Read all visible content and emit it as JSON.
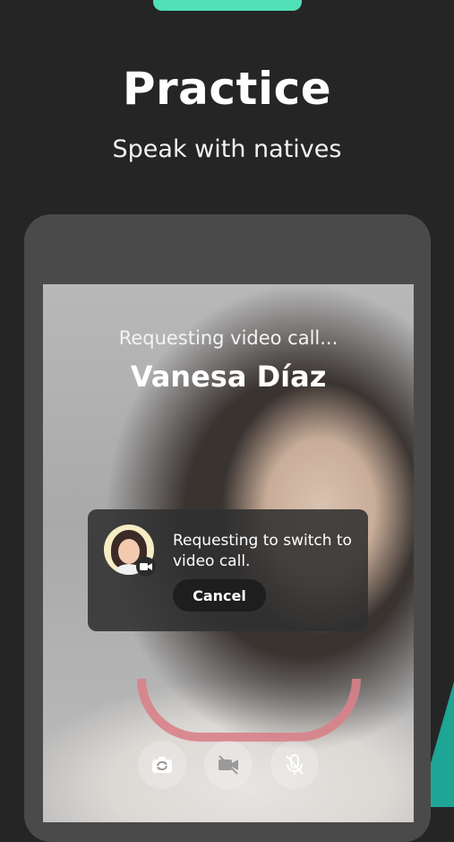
{
  "hero": {
    "title": "Practice",
    "subtitle": "Speak with natives"
  },
  "call": {
    "status_text": "Requesting video call...",
    "caller_name": "Vanesa Díaz"
  },
  "switch_request": {
    "message": "Requesting to switch to video call.",
    "cancel_label": "Cancel"
  },
  "controls": [
    {
      "icon": "switch-camera-icon"
    },
    {
      "icon": "video-off-icon"
    },
    {
      "icon": "mic-off-icon"
    }
  ],
  "colors": {
    "background": "#252525",
    "accent": "#4fe0b6",
    "teal": "#1ea596"
  }
}
